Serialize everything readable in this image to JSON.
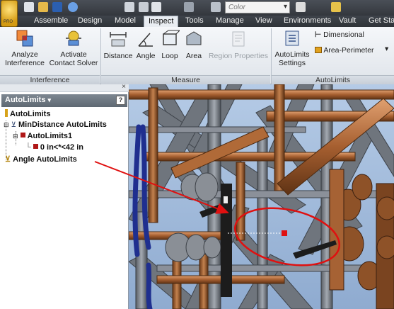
{
  "qat": {
    "color_value": "Color"
  },
  "tabs": [
    "Assemble",
    "Design",
    "Model",
    "Inspect",
    "Tools",
    "Manage",
    "View",
    "Environments",
    "Vault",
    "Get Sta"
  ],
  "active_tab": "Inspect",
  "ribbon": {
    "interference": {
      "label": "Interference",
      "analyze": [
        "Analyze",
        "Interference"
      ],
      "activate": [
        "Activate",
        "Contact Solver"
      ]
    },
    "measure": {
      "label": "Measure",
      "distance": "Distance",
      "angle": "Angle",
      "loop": "Loop",
      "area": "Area",
      "region": "Region Properties"
    },
    "autolimits": {
      "label": "AutoLimits",
      "settings": [
        "AutoLimits",
        "Settings"
      ],
      "dimensional": "Dimensional",
      "area_perimeter": "Area-Perimeter"
    }
  },
  "browser": {
    "title": "AutoLimits",
    "help": "?",
    "tree": {
      "root": "AutoLimits",
      "mindistance": "MinDistance AutoLimits",
      "autolimits1": "AutoLimits1",
      "limit_value": "0 in<*<42 in",
      "angle": "Angle AutoLimits"
    }
  },
  "colors": {
    "ribbon_bg": "#e6eaef",
    "tab_strip": "#353a40",
    "callout": "#e01010",
    "sky": "#a9c3e2",
    "steel": "#7b8088",
    "copper": "#b06a38",
    "blue_cable": "#1f2f8f"
  }
}
